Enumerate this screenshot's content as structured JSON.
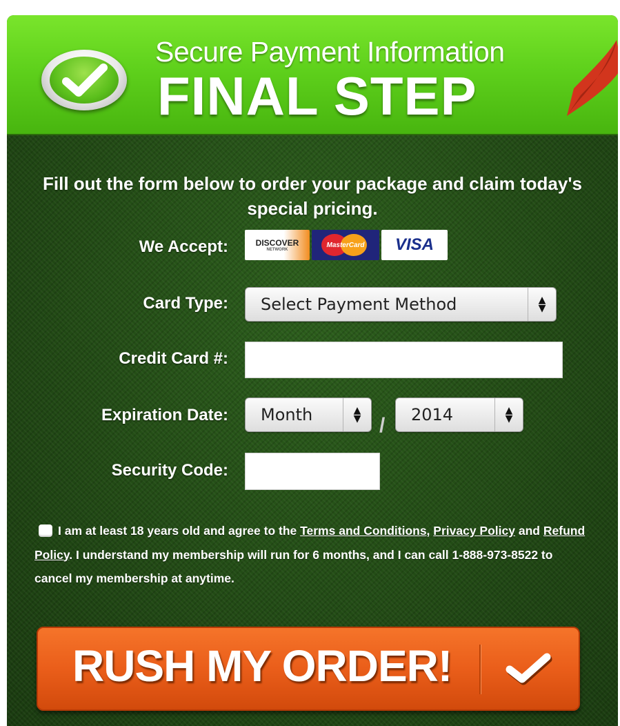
{
  "header": {
    "subtitle": "Secure Payment Information",
    "title": "FINAL STEP"
  },
  "intro_text": "Fill out the form below to order your package and claim today's special pricing.",
  "accept": {
    "label": "We Accept:",
    "cards": [
      {
        "name": "DISCOVER",
        "sub": "NETWORK"
      },
      {
        "name": "MasterCard"
      },
      {
        "name": "VISA"
      }
    ]
  },
  "form": {
    "card_type": {
      "label": "Card Type:",
      "value": "Select Payment Method"
    },
    "credit_card": {
      "label": "Credit Card #:",
      "value": ""
    },
    "expiration": {
      "label": "Expiration Date:",
      "month": "Month",
      "separator": "/",
      "year": "2014"
    },
    "security_code": {
      "label": "Security Code:",
      "value": ""
    }
  },
  "terms": {
    "text_1": "I am at least 18 years old and agree to the",
    "link_terms": "Terms and Conditions,",
    "link_privacy": "Privacy Policy",
    "text_and": "and",
    "link_refund": "Refund Policy",
    "text_2": ". I understand my membership will run for 6 months, and I can call 1-888-973-8522 to cancel my membership at anytime."
  },
  "cta": {
    "label": "RUSH MY ORDER!"
  },
  "colors": {
    "header_green": "#5fd11c",
    "panel_green": "#234d16",
    "button_orange": "#ea5e1a"
  },
  "icons": [
    "check-badge-icon",
    "checkmark-icon",
    "select-arrows-icon"
  ]
}
